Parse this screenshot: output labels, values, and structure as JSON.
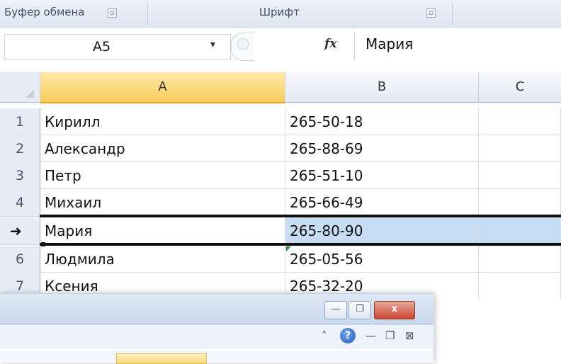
{
  "ribbon": {
    "clipboard_label": "Буфер обмена",
    "font_label": "Шрифт",
    "launcher_glyph": "⊡"
  },
  "formula_bar": {
    "name_box": "A5",
    "dropdown_glyph": "▾",
    "fx": "fx",
    "content": "Мария"
  },
  "columns": [
    "A",
    "B",
    "C"
  ],
  "rows": [
    {
      "num": "1",
      "a": "Кирилл",
      "b": "265-50-18"
    },
    {
      "num": "2",
      "a": "Александр",
      "b": "265-88-69"
    },
    {
      "num": "3",
      "a": "Петр",
      "b": "265-51-10"
    },
    {
      "num": "4",
      "a": "Михаил",
      "b": "265-66-49"
    },
    {
      "num": "5",
      "a": "Мария",
      "b": "265-80-90",
      "selected": true
    },
    {
      "num": "6",
      "a": "Людмила",
      "b": "265-05-56"
    },
    {
      "num": "7",
      "a": "Ксения",
      "b": "265-32-20"
    }
  ],
  "selected_row_indicator": "➜",
  "mini_window": {
    "minimize": "—",
    "restore": "❐",
    "close": "x",
    "ribbon_min_glyph": "˄",
    "help": "?",
    "ribbon_minimize": "—",
    "ribbon_restore": "❐",
    "ribbon_close": "⊠"
  },
  "colors": {
    "selected_header": "#f8cc5b",
    "row_highlight": "#c7ddf4",
    "ribbon_bg": "#dde5f0"
  }
}
